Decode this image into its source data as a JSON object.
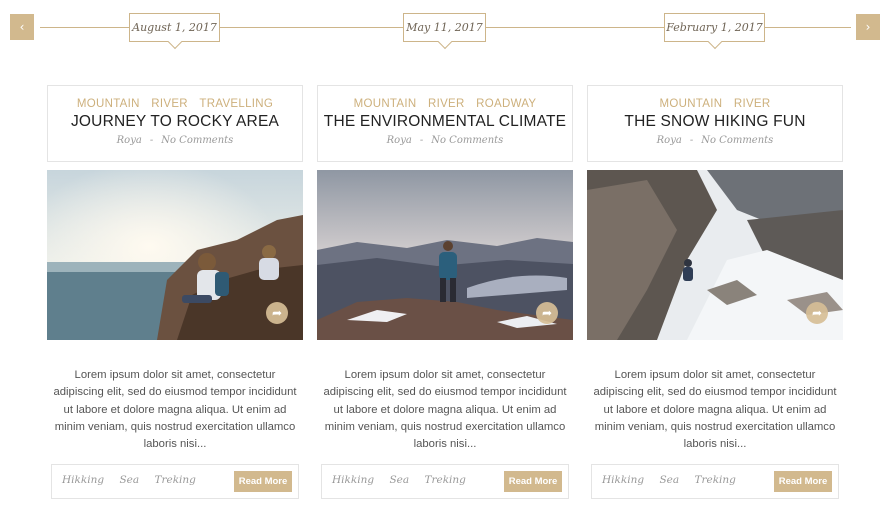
{
  "timeline": {
    "prev_icon": "chevron-left-icon",
    "next_icon": "chevron-right-icon",
    "prev_glyph": "‹",
    "next_glyph": "›",
    "dates": [
      "August 1, 2017",
      "May 11, 2017",
      "February 1, 2017"
    ]
  },
  "colors": {
    "accent": "#d2b98e",
    "category": "#cdb07c",
    "border": "#e4e4e4"
  },
  "posts": [
    {
      "categories": [
        "MOUNTAIN",
        "RIVER",
        "TRAVELLING"
      ],
      "title": "JOURNEY TO ROCKY AREA",
      "author": "Roya",
      "comments": "No Comments",
      "excerpt": "Lorem ipsum dolor sit amet, consectetur adipiscing elit, sed do eiusmod tempor incididunt ut labore et dolore magna aliqua. Ut enim ad minim veniam, quis nostrud exercitation ullamco laboris nisi...",
      "tags": [
        "Hikking",
        "Sea",
        "Treking"
      ],
      "read_more": "Read More",
      "share_icon": "share-icon"
    },
    {
      "categories": [
        "MOUNTAIN",
        "RIVER",
        "ROADWAY"
      ],
      "title": "THE ENVIRONMENTAL CLIMATE",
      "author": "Roya",
      "comments": "No Comments",
      "excerpt": "Lorem ipsum dolor sit amet, consectetur adipiscing elit, sed do eiusmod tempor incididunt ut labore et dolore magna aliqua. Ut enim ad minim veniam, quis nostrud exercitation ullamco laboris nisi...",
      "tags": [
        "Hikking",
        "Sea",
        "Treking"
      ],
      "read_more": "Read More",
      "share_icon": "share-icon"
    },
    {
      "categories": [
        "MOUNTAIN",
        "RIVER"
      ],
      "title": "THE SNOW HIKING FUN",
      "author": "Roya",
      "comments": "No Comments",
      "excerpt": "Lorem ipsum dolor sit amet, consectetur adipiscing elit, sed do eiusmod tempor incididunt ut labore et dolore magna aliqua. Ut enim ad minim veniam, quis nostrud exercitation ullamco laboris nisi...",
      "tags": [
        "Hikking",
        "Sea",
        "Treking"
      ],
      "read_more": "Read More",
      "share_icon": "share-icon"
    }
  ]
}
